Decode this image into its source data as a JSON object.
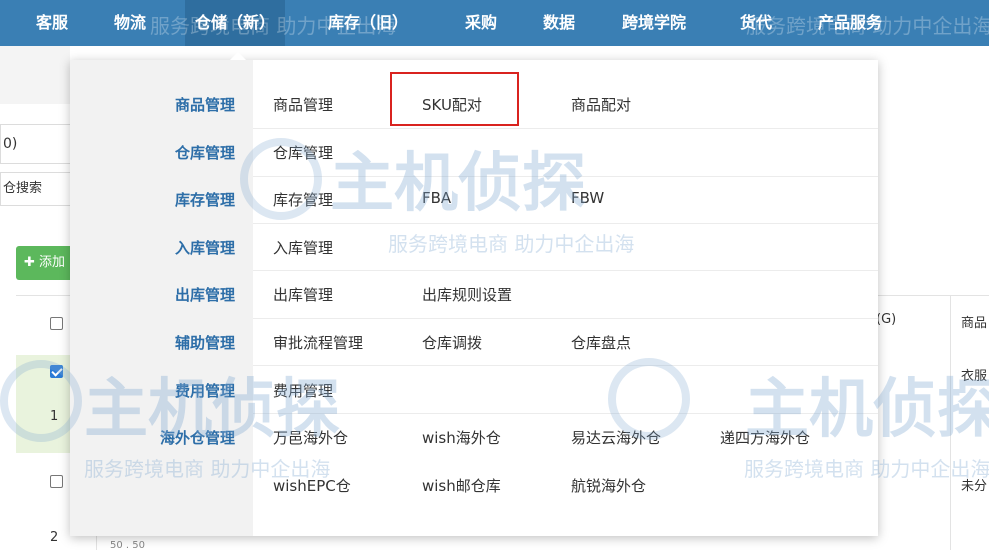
{
  "nav": {
    "items": [
      {
        "label": "客服"
      },
      {
        "label": "物流"
      },
      {
        "label": "仓储（新）"
      },
      {
        "label": "库存（旧）"
      },
      {
        "label": "采购"
      },
      {
        "label": "数据"
      },
      {
        "label": "跨境学院"
      },
      {
        "label": "货代"
      },
      {
        "label": "产品服务"
      }
    ],
    "active_index": 2
  },
  "background": {
    "count_fragment": "0)",
    "search_fragment": "仓搜索",
    "add_button": "添加",
    "rows": [
      "1",
      "2"
    ],
    "row_one_checked": true,
    "col_fragment_weight": "(G)",
    "col_fragment_product": "商品",
    "cell_fragment_clothing": "衣服",
    "cell_fragment_unassigned": "未分",
    "cell_fragment_bottom": "50 . 50"
  },
  "dropdown": {
    "categories": [
      {
        "label": "商品管理",
        "items": [
          "商品管理",
          "SKU配对",
          "商品配对"
        ]
      },
      {
        "label": "仓库管理",
        "items": [
          "仓库管理"
        ]
      },
      {
        "label": "库存管理",
        "items": [
          "库存管理",
          "FBA",
          "FBW"
        ]
      },
      {
        "label": "入库管理",
        "items": [
          "入库管理"
        ]
      },
      {
        "label": "出库管理",
        "items": [
          "出库管理",
          "出库规则设置"
        ]
      },
      {
        "label": "辅助管理",
        "items": [
          "审批流程管理",
          "仓库调拨",
          "仓库盘点"
        ]
      },
      {
        "label": "费用管理",
        "items": [
          "费用管理"
        ]
      },
      {
        "label": "海外仓管理",
        "items": [
          "万邑海外仓",
          "wish海外仓",
          "易达云海外仓",
          "递四方海外仓"
        ]
      },
      {
        "label": "",
        "items": [
          "wishEPC仓",
          "wish邮仓库",
          "航锐海外仓"
        ]
      }
    ],
    "highlighted_item": "SKU配对"
  },
  "watermark": {
    "brand": "主机侦探",
    "slogan": "服务跨境电商 助力中企出海"
  },
  "colors": {
    "nav_bg": "#3a7fb4",
    "category_text": "#2d6ea8",
    "highlight_border": "#d9231f",
    "add_button": "#5cb85c",
    "checkbox_checked": "#2a7bd6"
  }
}
